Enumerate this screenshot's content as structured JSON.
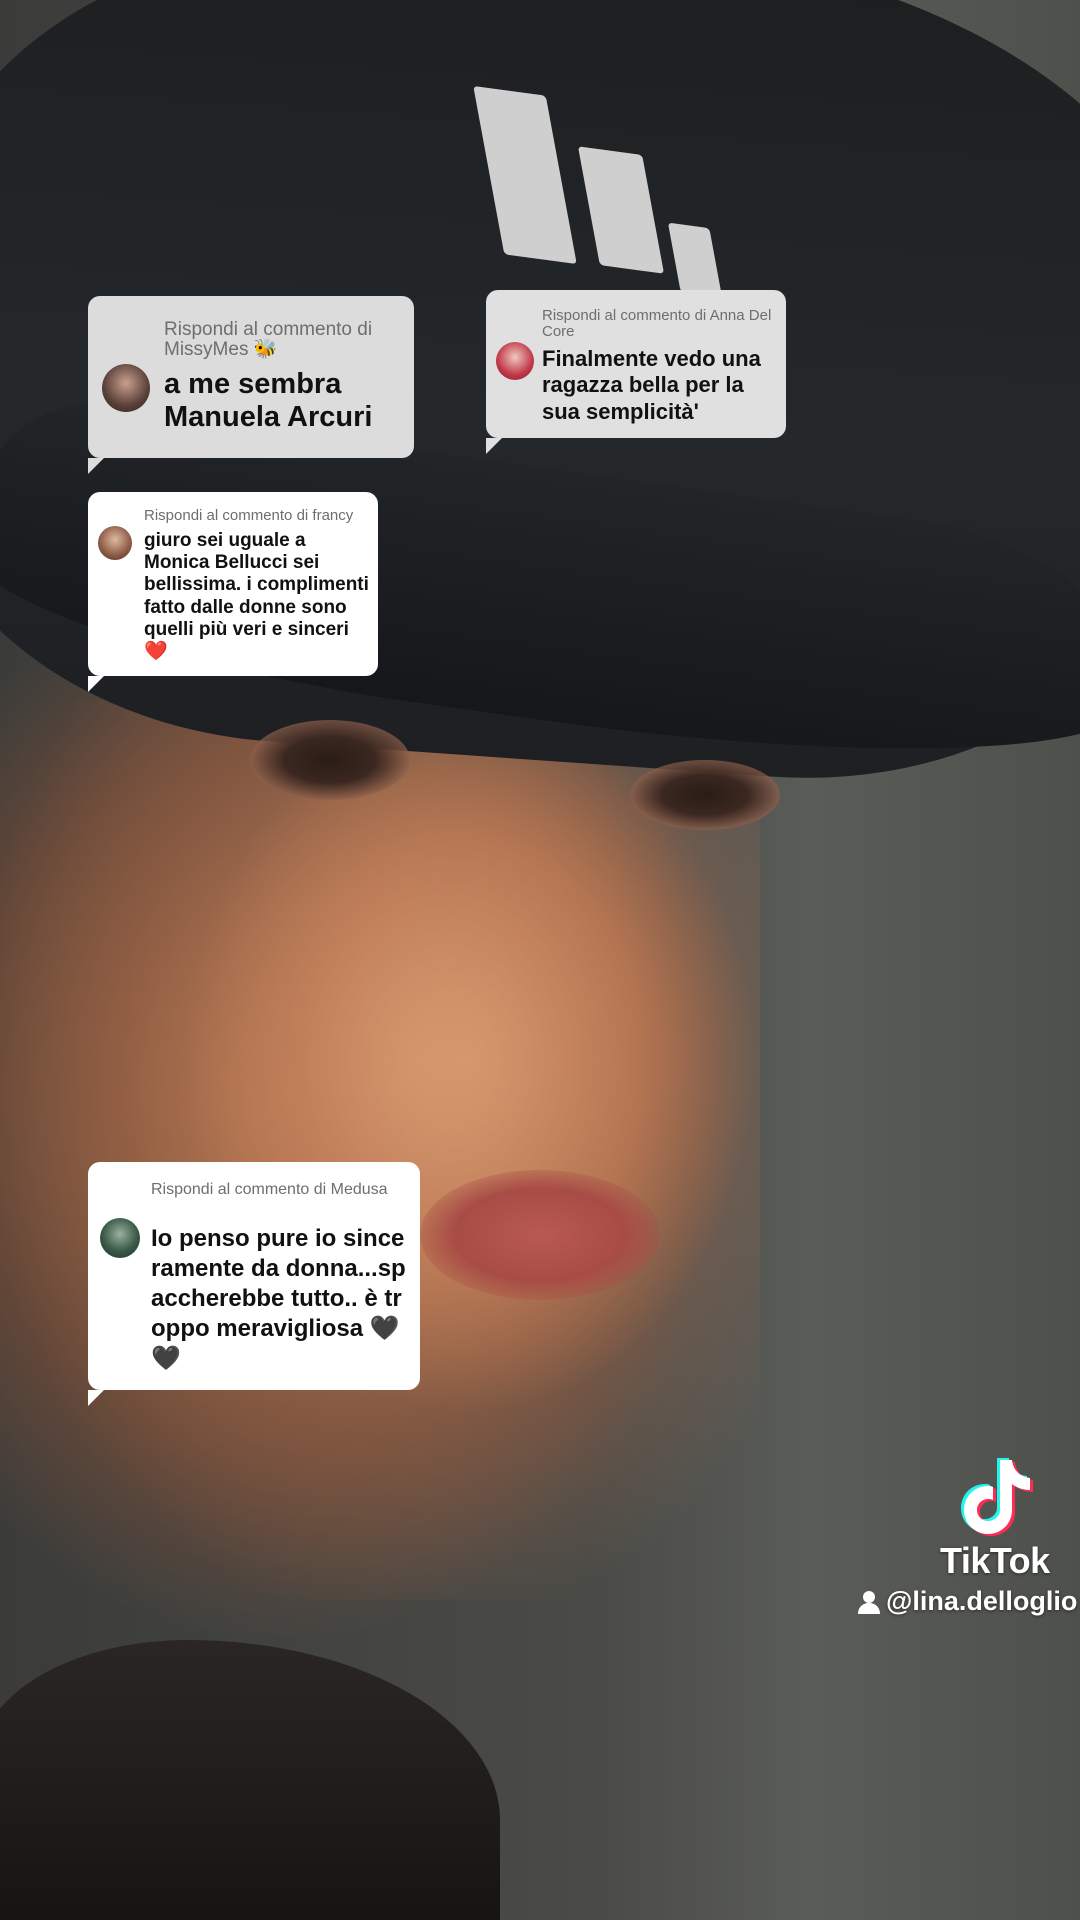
{
  "comments": [
    {
      "reply_label": "Rispondi al commento di MissyMes 🐝",
      "text": "a me sembra Manuela Arcuri",
      "avatar_icon": "user-avatar"
    },
    {
      "reply_label": "Rispondi al commento di Anna Del Core",
      "text": "Finalmente vedo una ragazza bella per la sua semplicità'",
      "avatar_icon": "user-avatar"
    },
    {
      "reply_label": "Rispondi al commento di francy",
      "text": "giuro sei uguale a Monica Bellucci sei bellissima. i complimenti fatto dalle donne sono quelli più veri e sinceri ❤️",
      "avatar_icon": "user-avatar"
    },
    {
      "reply_label": "Rispondi al commento di Medusa",
      "text": "Io penso pure io sinceramente da donna...spaccherebbe tutto.. è troppo meravigliosa 🖤🖤",
      "avatar_icon": "user-avatar"
    }
  ],
  "watermark": {
    "brand": "TikTok",
    "handle": "@lina.delloglio",
    "logo_icon": "tiktok-logo-icon",
    "user_icon": "person-icon"
  }
}
